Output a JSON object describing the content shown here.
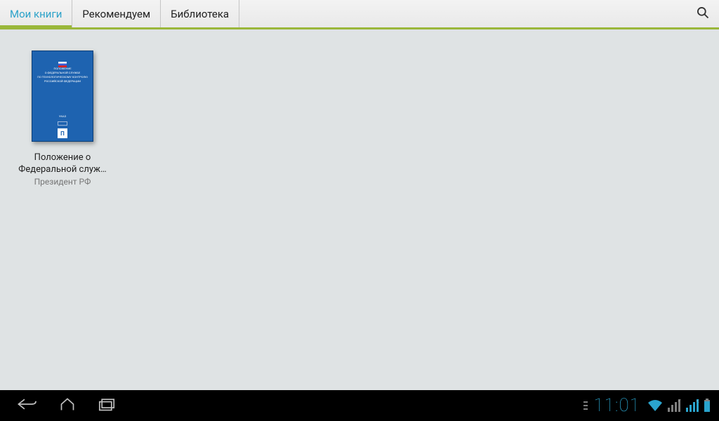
{
  "tabs": {
    "items": [
      {
        "label": "Мои книги"
      },
      {
        "label": "Рекомендуем"
      },
      {
        "label": "Библиотека"
      }
    ]
  },
  "books": [
    {
      "title": "Положение о Федеральной служ…",
      "author": "Президент РФ",
      "cover": {
        "line1": "ПОЛОЖЕНИЕ",
        "line2": "О ФЕДЕРАЛЬНОЙ СЛУЖБЕ",
        "line3": "ПО ТЕХНОЛОГИЧЕСКОМУ КОНТРОЛЮ",
        "line4": "РОССИЙСКОЙ ФЕДЕРАЦИИ",
        "badge": "УКАЗ",
        "publisher": "П"
      }
    }
  ],
  "statusbar": {
    "time": "11:01"
  }
}
